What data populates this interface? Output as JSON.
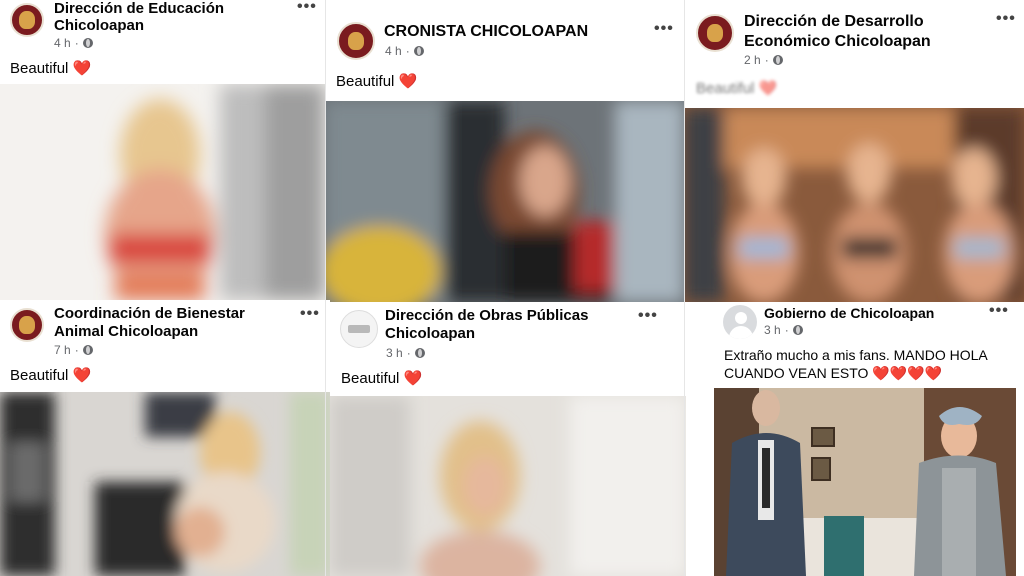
{
  "posts": [
    {
      "name": "Dirección de Educación\nChicoloapan",
      "time": "4 h",
      "caption": "Beautiful",
      "heart": "❤️"
    },
    {
      "name": "CRONISTA CHICOLOAPAN",
      "time": "4 h",
      "caption": "Beautiful",
      "heart": "❤️"
    },
    {
      "name": "Dirección de Desarrollo\nEconómico Chicoloapan",
      "time": "2 h",
      "caption": "Beautiful",
      "heart": "❤️"
    },
    {
      "name": "Coordinación de Bienestar\nAnimal Chicoloapan",
      "time": "7 h",
      "caption": "Beautiful",
      "heart": "❤️"
    },
    {
      "name": "Dirección de Obras Públicas\nChicoloapan",
      "time": "3 h",
      "caption": "Beautiful",
      "heart": "❤️"
    },
    {
      "name": "Gobierno de Chicoloapan",
      "time": "3 h",
      "caption": "Extraño mucho a mis fans. MANDO HOLA\nCUANDO VEAN ESTO",
      "heart": "❤️❤️❤️❤️"
    }
  ],
  "ui": {
    "more": "•••",
    "sep": "·"
  },
  "colors": {
    "brand_avatar": "#7a1b1f",
    "heart": "#e0112d",
    "meta_text": "#65676b"
  },
  "icons": [
    "globe-icon",
    "more-options-icon",
    "avatar-icon"
  ]
}
